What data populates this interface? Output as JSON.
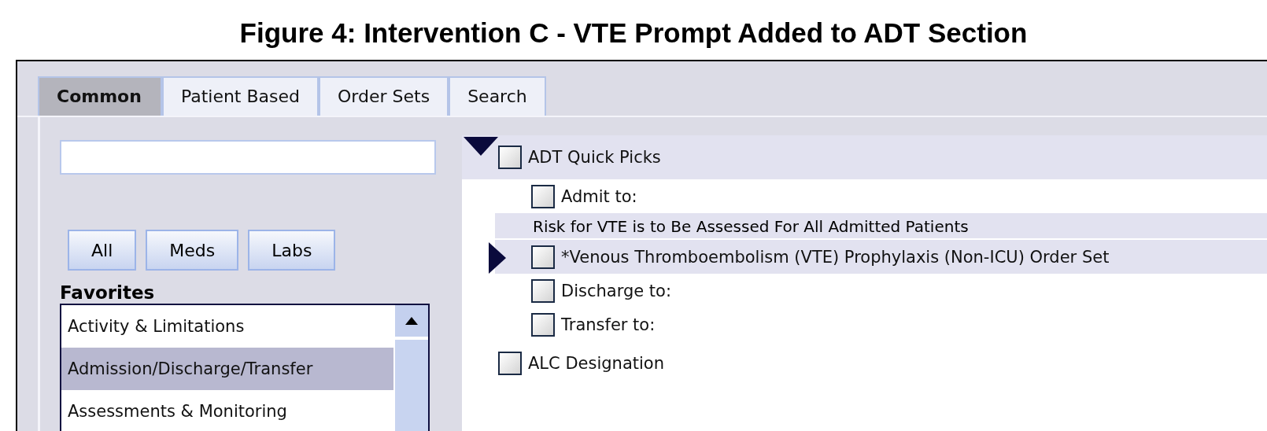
{
  "figure_title": "Figure 4: Intervention C - VTE Prompt Added to ADT Section",
  "tabs": [
    {
      "label": "Common",
      "selected": true
    },
    {
      "label": "Patient Based",
      "selected": false
    },
    {
      "label": "Order Sets",
      "selected": false
    },
    {
      "label": "Search",
      "selected": false
    }
  ],
  "filter_buttons": [
    "All",
    "Meds",
    "Labs"
  ],
  "favorites": {
    "heading": "Favorites",
    "items": [
      {
        "label": "Activity & Limitations",
        "selected": false
      },
      {
        "label": "Admission/Discharge/Transfer",
        "selected": true
      },
      {
        "label": "Assessments & Monitoring",
        "selected": false
      }
    ]
  },
  "orders": [
    {
      "kind": "group",
      "label": "ADT Quick Picks",
      "checked": false,
      "expanded": true,
      "children": [
        {
          "kind": "item",
          "label": "Admit to:",
          "checked": false
        },
        {
          "kind": "prompt",
          "label": "Risk for VTE is to Be Assessed For All Admitted Patients",
          "children": [
            {
              "kind": "item",
              "label": "*Venous Thromboembolism (VTE) Prophylaxis (Non-ICU) Order Set",
              "checked": false,
              "current": true
            }
          ]
        },
        {
          "kind": "item",
          "label": "Discharge to:",
          "checked": false
        },
        {
          "kind": "item",
          "label": "Transfer to:",
          "checked": false
        }
      ]
    },
    {
      "kind": "group",
      "label": "ALC Designation",
      "checked": false,
      "expanded": false
    }
  ]
}
